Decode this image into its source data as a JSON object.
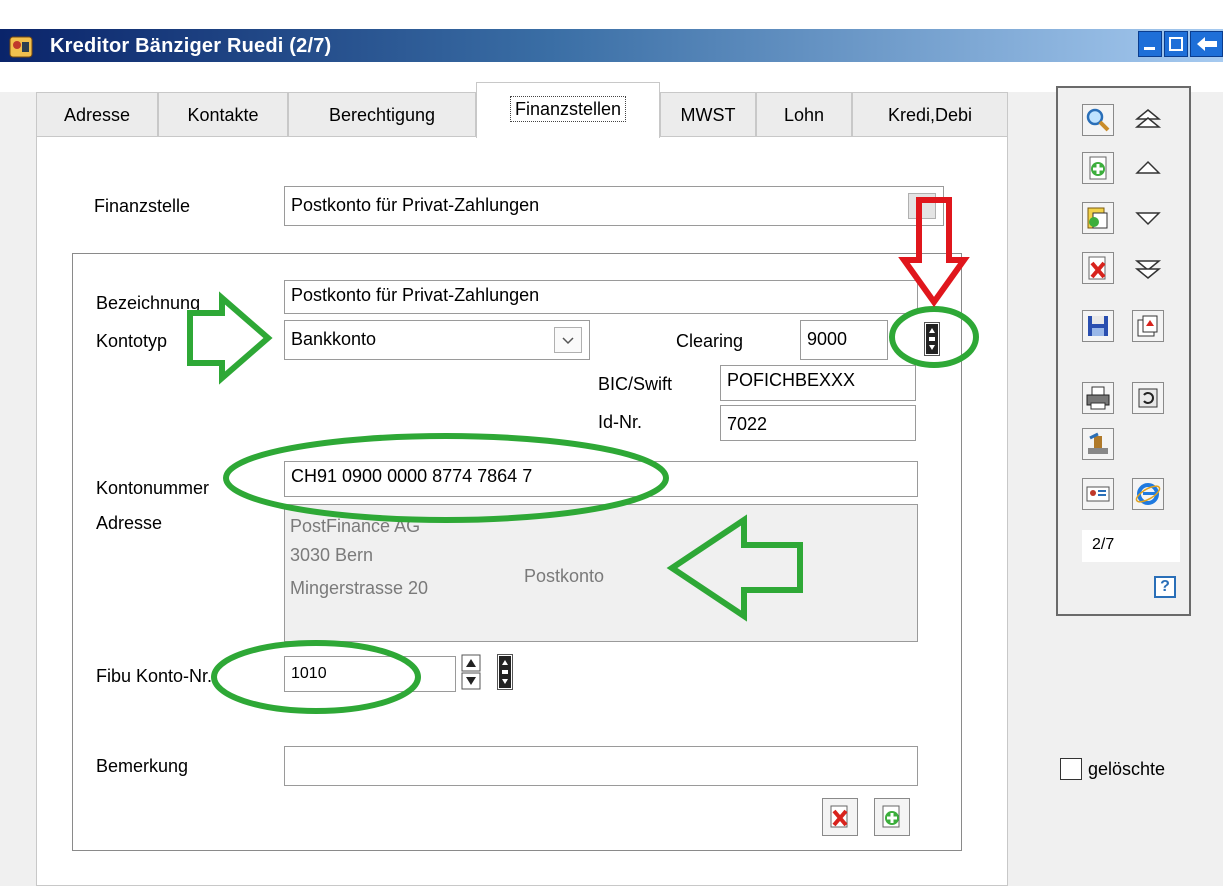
{
  "window": {
    "title": "Kreditor Bänziger Ruedi (2/7)"
  },
  "tabs": [
    {
      "label": "Adresse"
    },
    {
      "label": "Kontakte"
    },
    {
      "label": "Berechtigung"
    },
    {
      "label": "Finanzstellen",
      "active": true
    },
    {
      "label": "MWST"
    },
    {
      "label": "Lohn"
    },
    {
      "label": "Kredi,Debi"
    }
  ],
  "form": {
    "finanzstelle_label": "Finanzstelle",
    "finanzstelle_value": "Postkonto für Privat-Zahlungen",
    "bezeichnung_label": "Bezeichnung",
    "bezeichnung_value": "Postkonto für Privat-Zahlungen",
    "kontotyp_label": "Kontotyp",
    "kontotyp_value": "Bankkonto",
    "clearing_label": "Clearing",
    "clearing_value": "9000",
    "bic_label": "BIC/Swift",
    "bic_value": "POFICHBEXXX",
    "idnr_label": "Id-Nr.",
    "idnr_value": "7022",
    "kontonummer_label": "Kontonummer",
    "kontonummer_value": "CH91 0900 0000 8774 7864 7",
    "adresse_label": "Adresse",
    "adresse_lines": [
      "PostFinance AG",
      "3030 Bern",
      "Mingerstrasse 20"
    ],
    "adresse_type": "Postkonto",
    "fibu_label": "Fibu Konto-Nr.",
    "fibu_value": "1010",
    "bemerkung_label": "Bemerkung",
    "bemerkung_value": ""
  },
  "sidebar": {
    "record_counter": "2/7",
    "help_label": "?",
    "deleted_checkbox_label": "gelöschte",
    "deleted_checked": false
  },
  "colors": {
    "annotation_green": "#2ea836",
    "annotation_red": "#e0161c",
    "titlebar_start": "#0a246a",
    "titlebar_end": "#a6caf0"
  },
  "icons": {
    "toolbar": [
      "magnifier-icon",
      "first-record-icon",
      "new-record-icon",
      "previous-record-icon",
      "copy-record-icon",
      "next-record-icon",
      "delete-record-icon",
      "last-record-icon",
      "save-icon",
      "export-icon",
      "print-icon",
      "refresh-icon",
      "stamp-icon",
      "contact-card-icon",
      "internet-explorer-icon"
    ]
  }
}
